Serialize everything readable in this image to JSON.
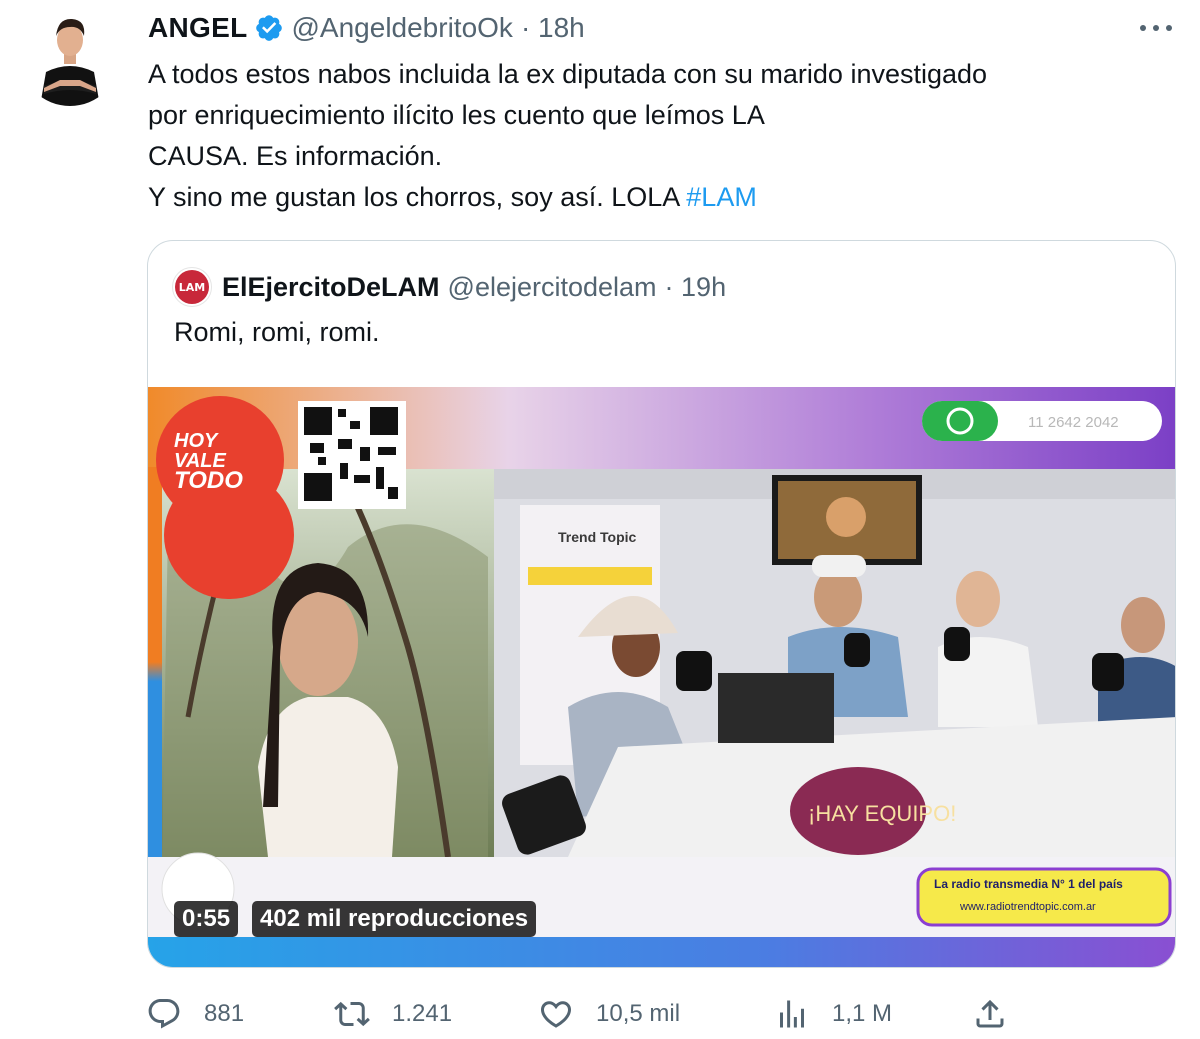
{
  "tweet": {
    "author_name": "ANGEL",
    "handle": "@AngeldebritoOk",
    "time": "· 18h",
    "lines": [
      "A todos estos nabos incluida la ex diputada con su marido investigado",
      "por enriquecimiento ilícito les cuento que leímos LA",
      "CAUSA. Es información.",
      "Y sino me gustan los chorros, soy así. LOLA "
    ],
    "hashtag": "#LAM"
  },
  "quote": {
    "author_name": "ElEjercitoDeLAM",
    "handle": "@elejercitodelam",
    "time": "· 19h",
    "avatar_text": "LAM",
    "text": "Romi, romi, romi."
  },
  "video": {
    "duration": "0:55",
    "views": "402 mil reproducciones",
    "logo_lines": [
      "HOY",
      "VALE",
      "TODO"
    ],
    "phone_number": "11 2642 2042",
    "studio_sign": "¡HAY EQUIPO!",
    "banner_line1": "La radio transmedia N° 1 del país",
    "banner_line2": "www.radiotrendtopic.com.ar",
    "brand": "Trend Topic"
  },
  "actions": {
    "replies": "881",
    "retweets": "1.241",
    "likes": "10,5 mil",
    "views": "1,1 M"
  },
  "colors": {
    "link": "#1d9bf0",
    "verified": "#1d9bf0",
    "muted": "#536471",
    "border": "#cfd9de"
  }
}
